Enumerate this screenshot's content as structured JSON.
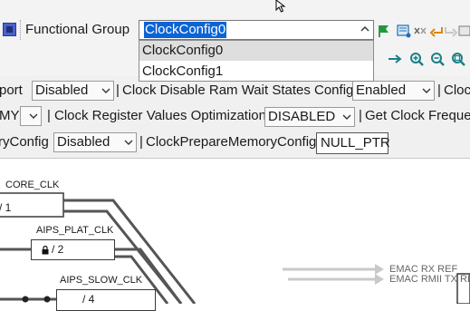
{
  "functional_group": {
    "label": "Functional Group",
    "selected": "ClockConfig0",
    "options": [
      "ClockConfig0",
      "ClockConfig1"
    ]
  },
  "settings": {
    "row1": {
      "lead": "port",
      "first_value": "Disabled",
      "sep1": "|",
      "label2": "Clock Disable Ram Wait States Config",
      "value2": "Enabled",
      "sep2": "|",
      "label3": "Cloc"
    },
    "row2": {
      "lead": "MY",
      "sep1": "|",
      "label2": "Clock Register Values Optimization",
      "value2": "DISABLED",
      "sep2": "|",
      "label3": "Get Clock Frequen"
    },
    "row3": {
      "lead": "ryConfig",
      "value1": "Disabled",
      "sep1": "|",
      "label2": "ClockPrepareMemoryConfig",
      "value2": "NULL_PTR"
    }
  },
  "diagram": {
    "core_clk": {
      "label": "CORE_CLK",
      "divider": "/ 1"
    },
    "aips_plat_clk": {
      "label": "AIPS_PLAT_CLK",
      "divider": "/ 2"
    },
    "aips_slow_clk": {
      "label": "AIPS_SLOW_CLK",
      "divider": "/ 4"
    },
    "signals": [
      "EMAC RX REF",
      "EMAC RMII TX REF"
    ]
  },
  "colors": {
    "selection": "#0a64d6",
    "toolbar_bg": "#f3f3f3",
    "accent_green": "#1f9a3a",
    "accent_blue": "#1d6fb8",
    "accent_orange": "#d48a12"
  }
}
